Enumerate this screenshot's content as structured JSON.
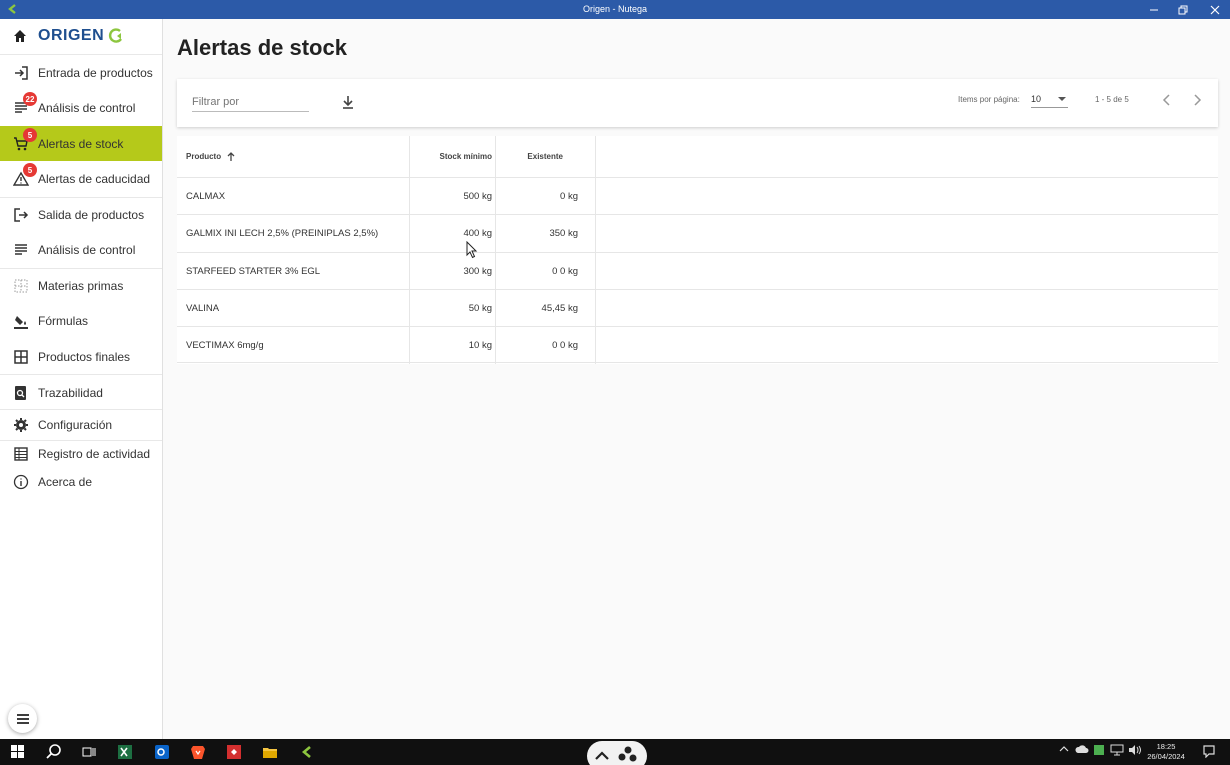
{
  "window": {
    "title": "Origen - Nutega"
  },
  "sidebar": {
    "brand": "ORIGEN",
    "items": [
      {
        "label": "Entrada de productos",
        "icon": "login-icon"
      },
      {
        "label": "Análisis de control",
        "icon": "list-icon",
        "badge": "22"
      },
      {
        "label": "Alertas de stock",
        "icon": "cart-icon",
        "badge": "5",
        "active": true
      },
      {
        "label": "Alertas de caducidad",
        "icon": "warning-icon",
        "badge": "5"
      },
      {
        "label": "Salida de productos",
        "icon": "logout-icon"
      },
      {
        "label": "Análisis de control",
        "icon": "list-icon"
      },
      {
        "label": "Materias primas",
        "icon": "grid-dotted-icon"
      },
      {
        "label": "Fórmulas",
        "icon": "paint-bucket-icon"
      },
      {
        "label": "Productos finales",
        "icon": "grid-icon"
      },
      {
        "label": "Trazabilidad",
        "icon": "search-document-icon"
      },
      {
        "label": "Configuración",
        "icon": "gear-icon"
      },
      {
        "label": "Registro de actividad",
        "icon": "table-icon"
      },
      {
        "label": "Acerca de",
        "icon": "info-icon"
      }
    ]
  },
  "main": {
    "title": "Alertas de stock",
    "filter": {
      "placeholder": "Filtrar por"
    },
    "pagination": {
      "items_label": "Items por página:",
      "page_size": "10",
      "range": "1 - 5 de 5"
    },
    "table": {
      "headers": [
        "Producto",
        "Stock mínimo",
        "Existente"
      ],
      "rows": [
        [
          "CALMAX",
          "500 kg",
          "0 kg"
        ],
        [
          "GALMIX INI LECH 2,5% (PREINIPLAS 2,5%)",
          "400 kg",
          "350 kg"
        ],
        [
          "STARFEED STARTER 3% EGL",
          "300 kg",
          "0 0 kg"
        ],
        [
          "VALINA",
          "50 kg",
          "45,45 kg"
        ],
        [
          "VECTIMAX 6mg/g",
          "10 kg",
          "0 0 kg"
        ]
      ]
    }
  },
  "taskbar": {
    "time": "18:25",
    "date": "26/04/2024"
  },
  "colors": {
    "titlebar": "#2c5aa8",
    "active": "#b5c91a",
    "brand": "#1f4f8f",
    "badge": "#e53935",
    "brand_green": "#8dc63f"
  }
}
